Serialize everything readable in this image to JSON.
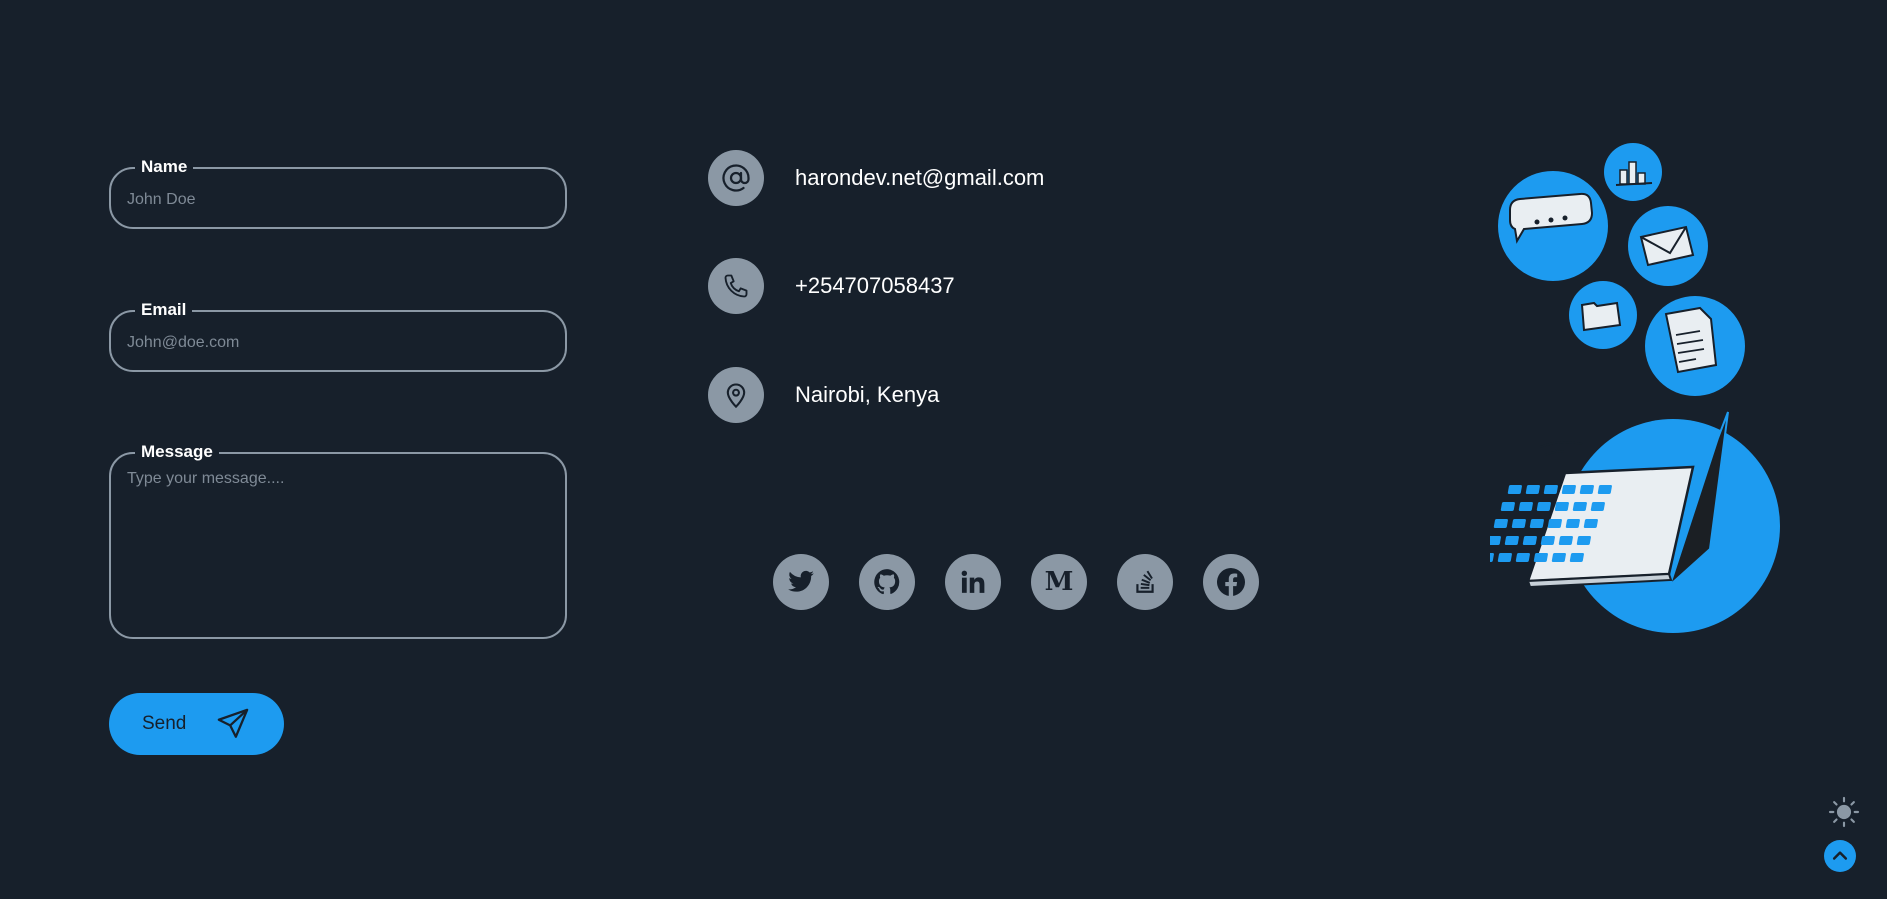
{
  "form": {
    "name": {
      "label": "Name",
      "placeholder": "John Doe"
    },
    "email": {
      "label": "Email",
      "placeholder": "John@doe.com"
    },
    "message": {
      "label": "Message",
      "placeholder": "Type your message...."
    },
    "send_label": "Send"
  },
  "contact": {
    "email": "harondev.net@gmail.com",
    "phone": "+254707058437",
    "location": "Nairobi, Kenya"
  },
  "socials": [
    {
      "name": "twitter-icon"
    },
    {
      "name": "github-icon"
    },
    {
      "name": "linkedin-icon"
    },
    {
      "name": "medium-icon",
      "glyph": "M"
    },
    {
      "name": "stackoverflow-icon"
    },
    {
      "name": "facebook-icon"
    }
  ],
  "colors": {
    "background": "#17202b",
    "accent": "#1d9bf0",
    "muted": "#8b98a5"
  }
}
